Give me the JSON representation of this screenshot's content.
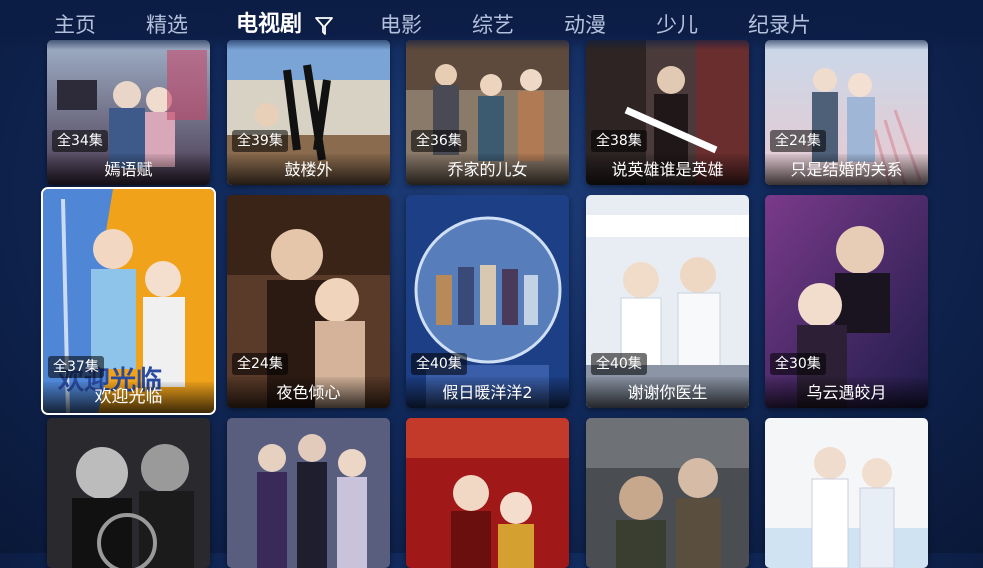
{
  "nav": {
    "items": [
      "主页",
      "精选",
      "电视剧",
      "电影",
      "综艺",
      "动漫",
      "少儿",
      "纪录片"
    ],
    "active_index": 2
  },
  "colors": {
    "background": "#112a5c",
    "text_active": "#ffffff",
    "text_inactive": "#b4c1dc"
  },
  "rows": [
    [
      {
        "title": "嫣语赋",
        "episodes": "全34集"
      },
      {
        "title": "鼓楼外",
        "episodes": "全39集"
      },
      {
        "title": "乔家的儿女",
        "episodes": "全36集"
      },
      {
        "title": "说英雄谁是英雄",
        "episodes": "全38集"
      },
      {
        "title": "只是结婚的关系",
        "episodes": "全24集"
      }
    ],
    [
      {
        "title": "欢迎光临",
        "episodes": "全37集",
        "selected": true
      },
      {
        "title": "夜色倾心",
        "episodes": "全24集"
      },
      {
        "title": "假日暖洋洋2",
        "episodes": "全40集"
      },
      {
        "title": "谢谢你医生",
        "episodes": "全40集"
      },
      {
        "title": "乌云遇皎月",
        "episodes": "全30集"
      }
    ],
    [
      {
        "title": "",
        "episodes": ""
      },
      {
        "title": "",
        "episodes": ""
      },
      {
        "title": "",
        "episodes": ""
      },
      {
        "title": "",
        "episodes": ""
      },
      {
        "title": "",
        "episodes": ""
      }
    ]
  ]
}
